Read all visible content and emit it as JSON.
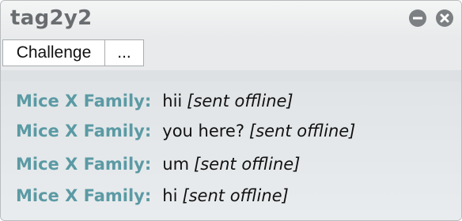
{
  "window": {
    "title": "tag2y2",
    "controls": [
      "minimize-icon",
      "close-icon"
    ]
  },
  "toolbar": {
    "challenge_label": "Challenge",
    "more_label": "..."
  },
  "messages": [
    {
      "sender": "Mice X Family:",
      "text": "hii",
      "note": "[sent offline]"
    },
    {
      "sender": "Mice X Family:",
      "text": "you here?",
      "note": "[sent offline]"
    },
    {
      "sender": "Mice X Family:",
      "text": "um",
      "note": "[sent offline]"
    },
    {
      "sender": "Mice X Family:",
      "text": "hi",
      "note": "[sent offline]"
    }
  ],
  "colors": {
    "sender": "#5b9aa4",
    "title": "#6a6d70",
    "window_bg": "#e9ecee"
  }
}
